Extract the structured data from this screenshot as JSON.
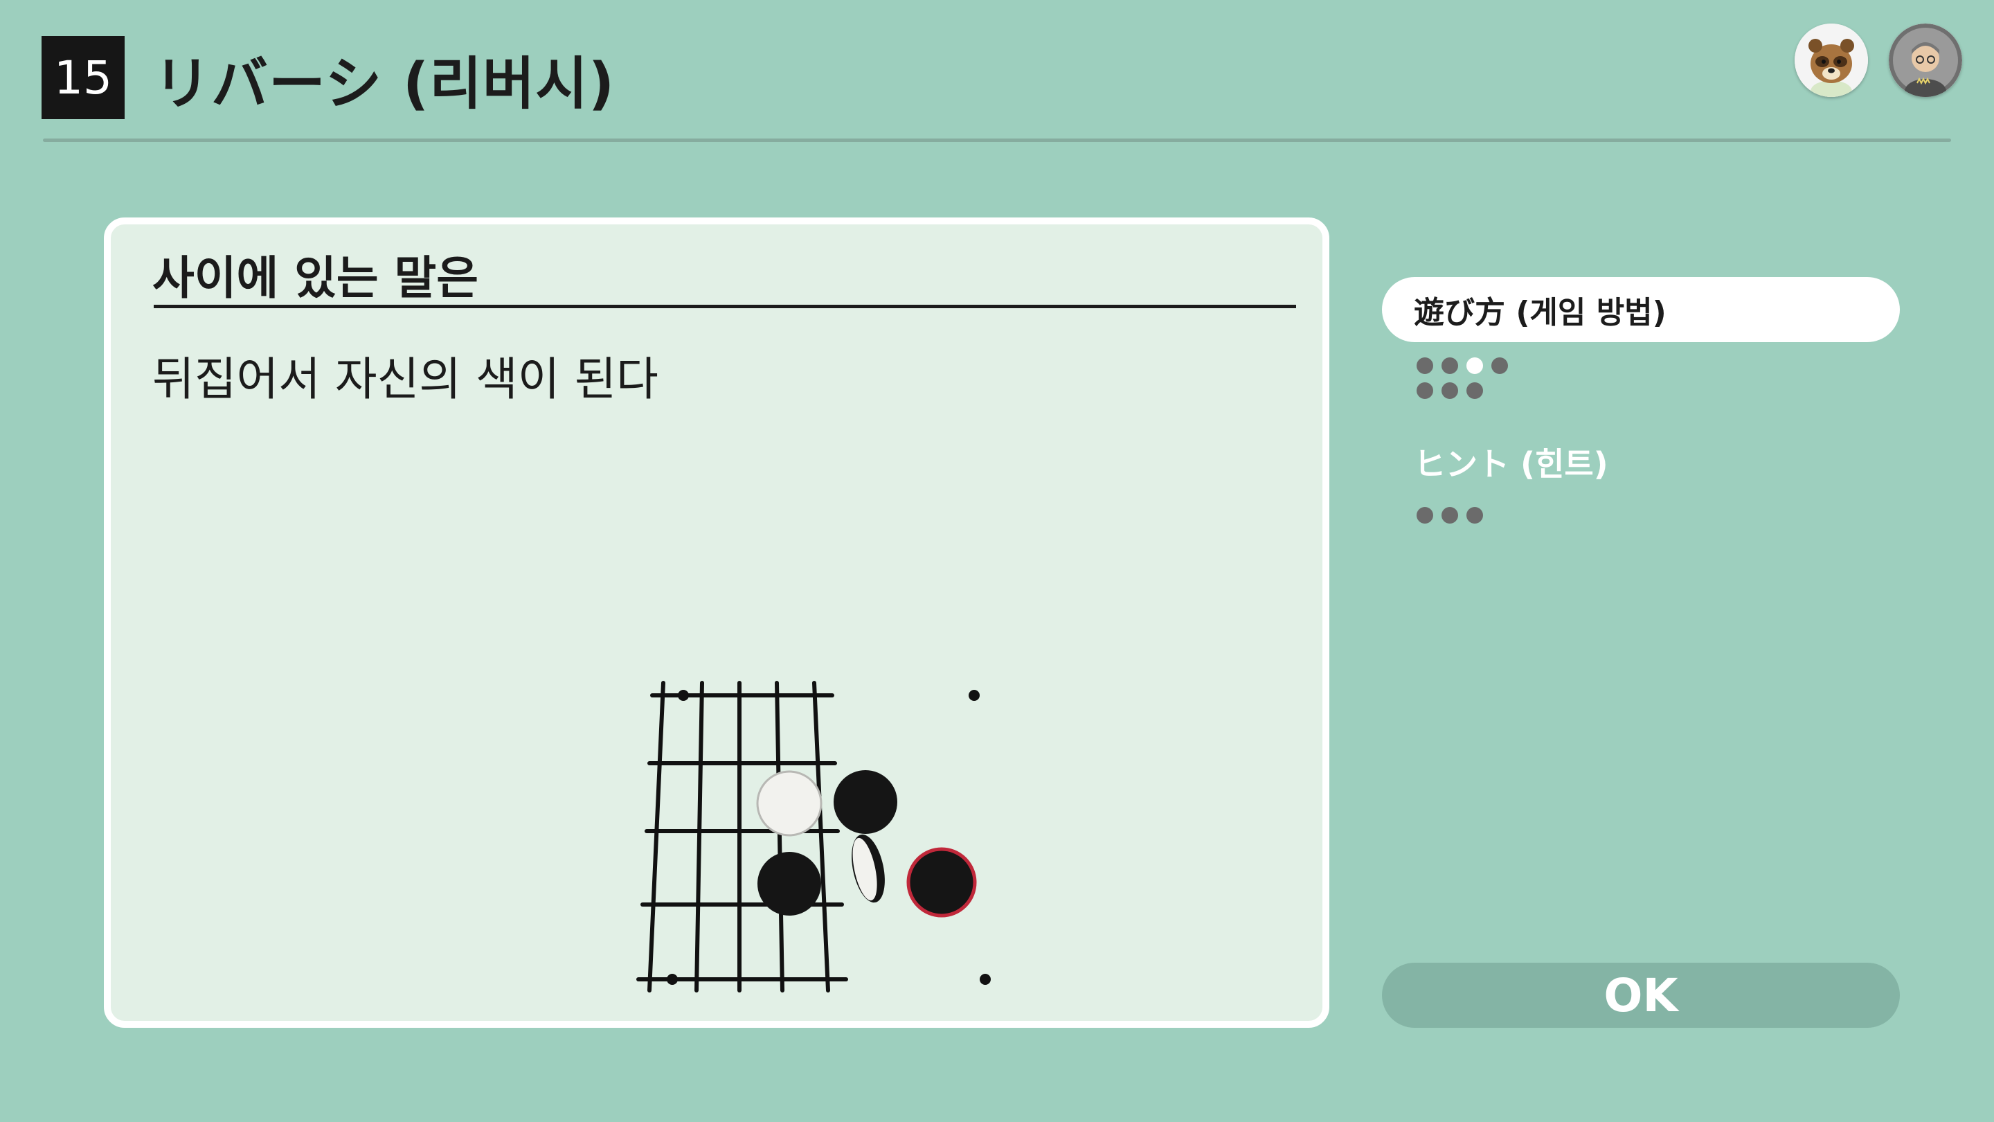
{
  "header": {
    "game_number": "15",
    "title": "リバーシ (리버시)"
  },
  "avatars": [
    {
      "icon": "raccoon-character-avatar-icon"
    },
    {
      "icon": "player-avatar-icon"
    }
  ],
  "card": {
    "heading": "사이에 있는 말은",
    "body": "뒤집어서 자신의 색이 된다",
    "board": {
      "grid_size": 5,
      "pieces": [
        {
          "color": "white",
          "state": "placed"
        },
        {
          "color": "black",
          "state": "placed"
        },
        {
          "color": "black",
          "state": "placed"
        },
        {
          "color": "black/white",
          "state": "flipping"
        },
        {
          "color": "black",
          "state": "just-placed",
          "outline": "#c0283a"
        }
      ]
    }
  },
  "menu": {
    "items": [
      {
        "label": "遊び方 (게임 방법)",
        "selected": true
      },
      {
        "label": "ヒント (힌트)",
        "selected": false
      }
    ],
    "how_to_play_pages": {
      "total": 7,
      "current": 3
    },
    "hint_pages": {
      "total": 3
    }
  },
  "ok_button": {
    "label": "OK"
  },
  "colors": {
    "background": "#9dcfbe",
    "card_background": "#e2f0e6",
    "ok_button": "#84b4a5",
    "dot_inactive": "#6b6b6b",
    "dot_active": "#ffffff",
    "highlight_outline": "#c0283a"
  }
}
